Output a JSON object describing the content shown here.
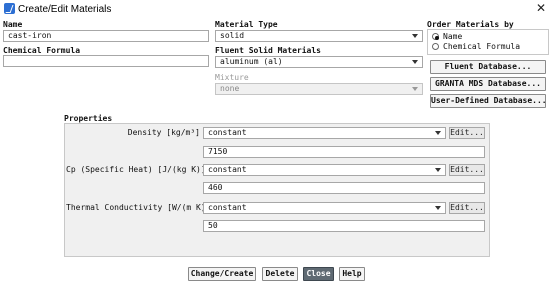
{
  "window": {
    "title": "Create/Edit Materials",
    "close_glyph": "✕"
  },
  "name": {
    "label": "Name",
    "value": "cast-iron"
  },
  "chemical_formula": {
    "label": "Chemical Formula",
    "value": ""
  },
  "material_type": {
    "label": "Material Type",
    "value": "solid"
  },
  "fluent_solid": {
    "label": "Fluent Solid Materials",
    "value": "aluminum (al)"
  },
  "mixture": {
    "label": "Mixture",
    "value": "none"
  },
  "order": {
    "label": "Order Materials by",
    "options": [
      {
        "label": "Name",
        "selected": true
      },
      {
        "label": "Chemical Formula",
        "selected": false
      }
    ]
  },
  "db_buttons": [
    "Fluent Database...",
    "GRANTA MDS Database...",
    "User-Defined Database..."
  ],
  "properties": {
    "label": "Properties",
    "rows": [
      {
        "label": "Density [kg/m³]",
        "method": "constant",
        "value": "7150",
        "edit": "Edit..."
      },
      {
        "label": "Cp (Specific Heat) [J/(kg K)]",
        "method": "constant",
        "value": "460",
        "edit": "Edit..."
      },
      {
        "label": "Thermal Conductivity [W/(m K)]",
        "method": "constant",
        "value": "50",
        "edit": "Edit..."
      }
    ]
  },
  "footer": {
    "change_create": "Change/Create",
    "delete": "Delete",
    "close": "Close",
    "help": "Help"
  }
}
